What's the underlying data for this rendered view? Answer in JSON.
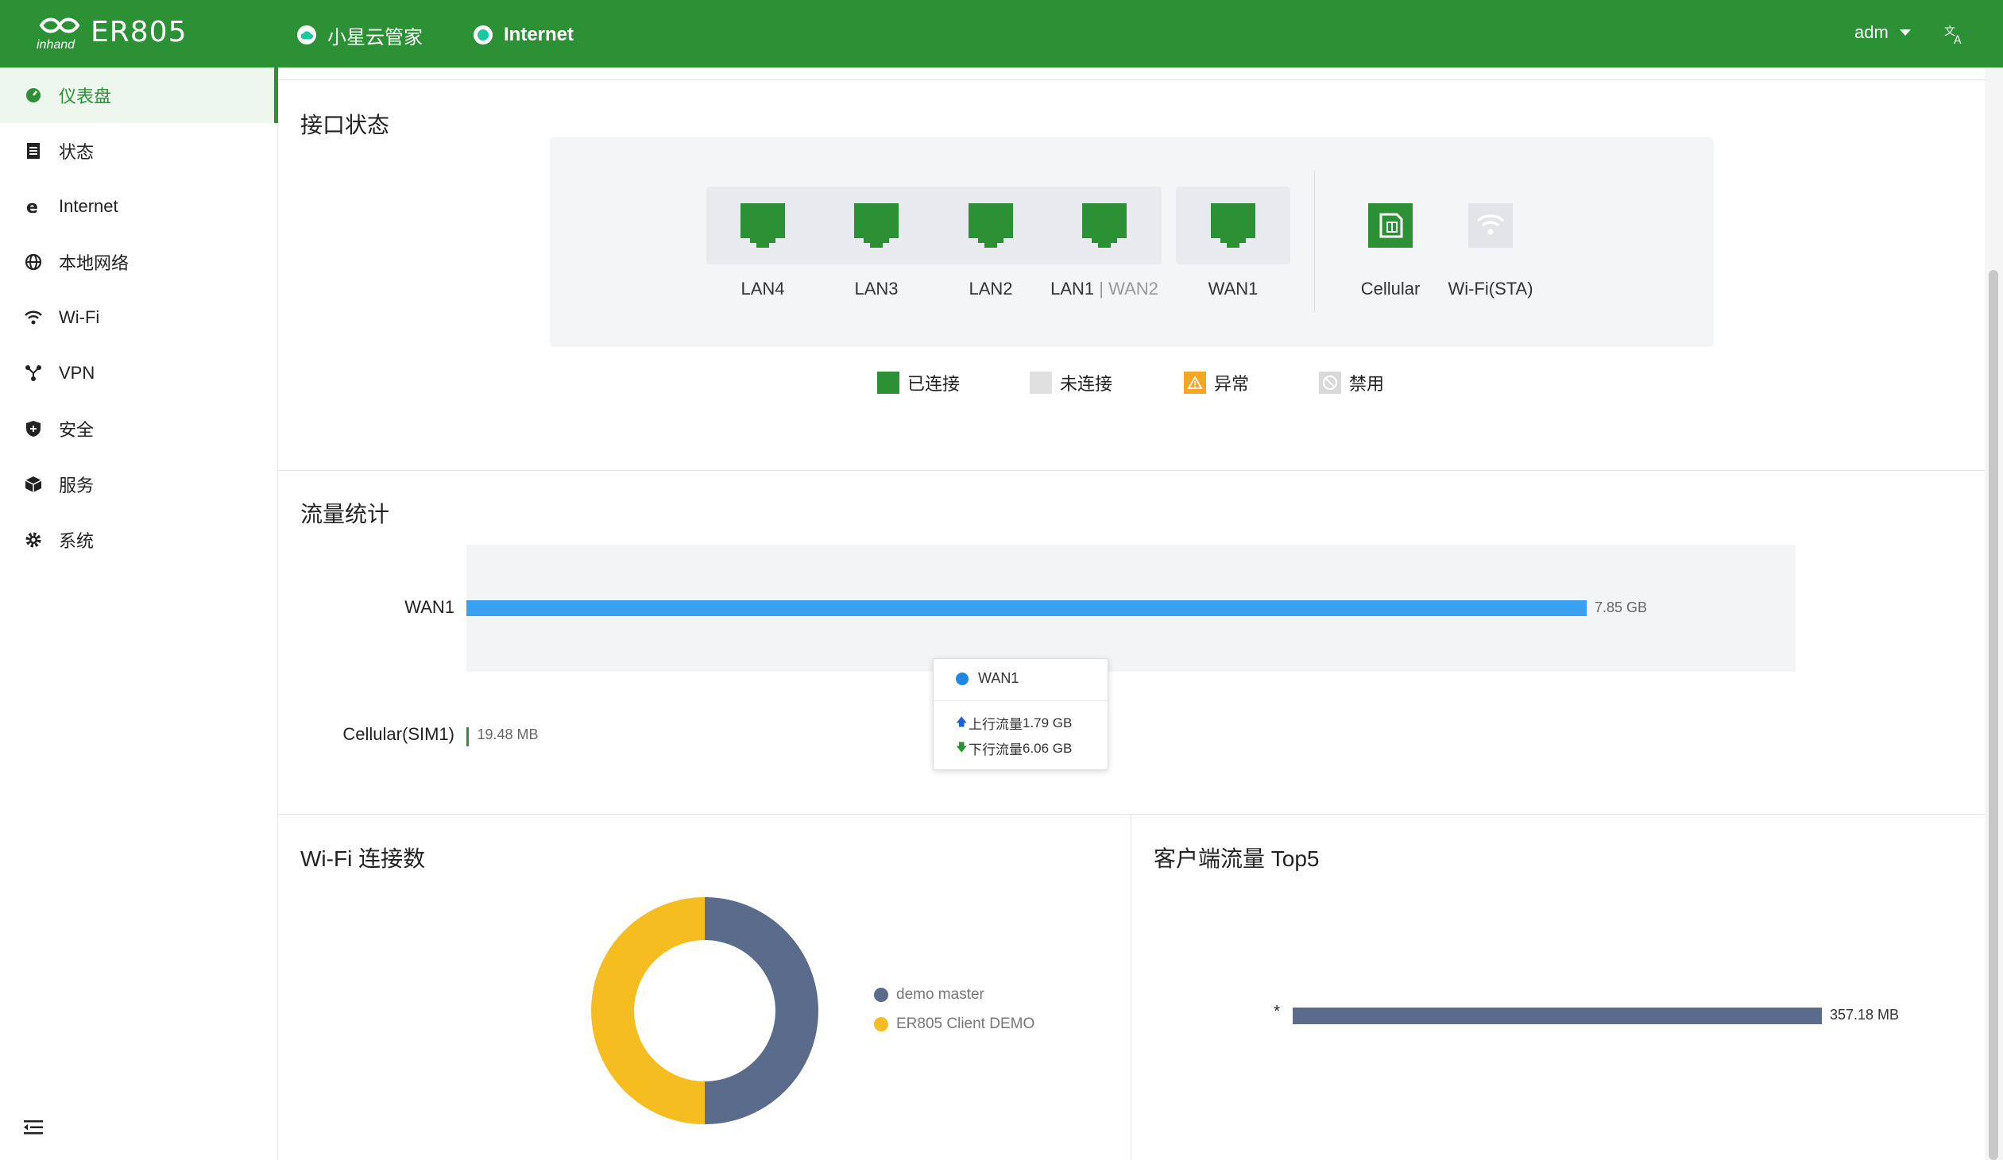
{
  "header": {
    "product": "ER805",
    "brand": "inhand",
    "nav": [
      {
        "label": "小星云管家"
      },
      {
        "label": "Internet"
      }
    ],
    "user": "adm"
  },
  "sidebar": {
    "items": [
      {
        "label": "仪表盘",
        "icon": "dashboard-icon",
        "active": true
      },
      {
        "label": "状态",
        "icon": "list-icon"
      },
      {
        "label": "Internet",
        "icon": "internet-explorer-icon"
      },
      {
        "label": "本地网络",
        "icon": "globe-icon"
      },
      {
        "label": "Wi-Fi",
        "icon": "wifi-icon"
      },
      {
        "label": "VPN",
        "icon": "vpn-nodes-icon"
      },
      {
        "label": "安全",
        "icon": "shield-icon"
      },
      {
        "label": "服务",
        "icon": "cube-icon"
      },
      {
        "label": "系统",
        "icon": "gear-icon"
      }
    ]
  },
  "interface_status": {
    "title": "接口状态",
    "ports": [
      {
        "label": "LAN4",
        "status": "connected"
      },
      {
        "label": "LAN3",
        "status": "connected"
      },
      {
        "label": "LAN2",
        "status": "connected"
      },
      {
        "label": "LAN1",
        "alt_label": "WAN2",
        "status": "connected"
      },
      {
        "label": "WAN1",
        "status": "connected"
      }
    ],
    "extra": [
      {
        "label": "Cellular",
        "status": "connected"
      },
      {
        "label": "Wi-Fi(STA)",
        "status": "disconnected"
      }
    ],
    "legend": [
      {
        "label": "已连接",
        "color": "#2b9134"
      },
      {
        "label": "未连接",
        "color": "#e0e0e0"
      },
      {
        "label": "异常",
        "color": "#f5a623"
      },
      {
        "label": "禁用",
        "color": "#d9d9d9"
      }
    ]
  },
  "traffic": {
    "title": "流量统计",
    "tooltip": {
      "series": "WAN1",
      "up_label": "上行流量",
      "up_value": "1.79 GB",
      "down_label": "下行流量",
      "down_value": "6.06 GB"
    }
  },
  "wifi_clients": {
    "title": "Wi-Fi 连接数"
  },
  "top_clients": {
    "title": "客户端流量 Top5"
  },
  "chart_data": [
    {
      "type": "bar",
      "orientation": "horizontal",
      "categories": [
        "WAN1",
        "Cellular(SIM1)"
      ],
      "values": [
        7850,
        19.48
      ],
      "value_labels": [
        "7.85 GB",
        "19.48 MB"
      ],
      "colors": [
        "#3aa0f0",
        "#2b9134"
      ]
    },
    {
      "type": "pie",
      "style": "donut",
      "series": [
        {
          "name": "demo master",
          "value": 1,
          "color": "#5b6b8c"
        },
        {
          "name": "ER805 Client DEMO",
          "value": 1,
          "color": "#f5bd1f"
        }
      ]
    },
    {
      "type": "bar",
      "orientation": "horizontal",
      "categories": [
        "*"
      ],
      "values": [
        357.18
      ],
      "value_labels": [
        "357.18 MB"
      ],
      "colors": [
        "#5b6b8c"
      ]
    }
  ]
}
